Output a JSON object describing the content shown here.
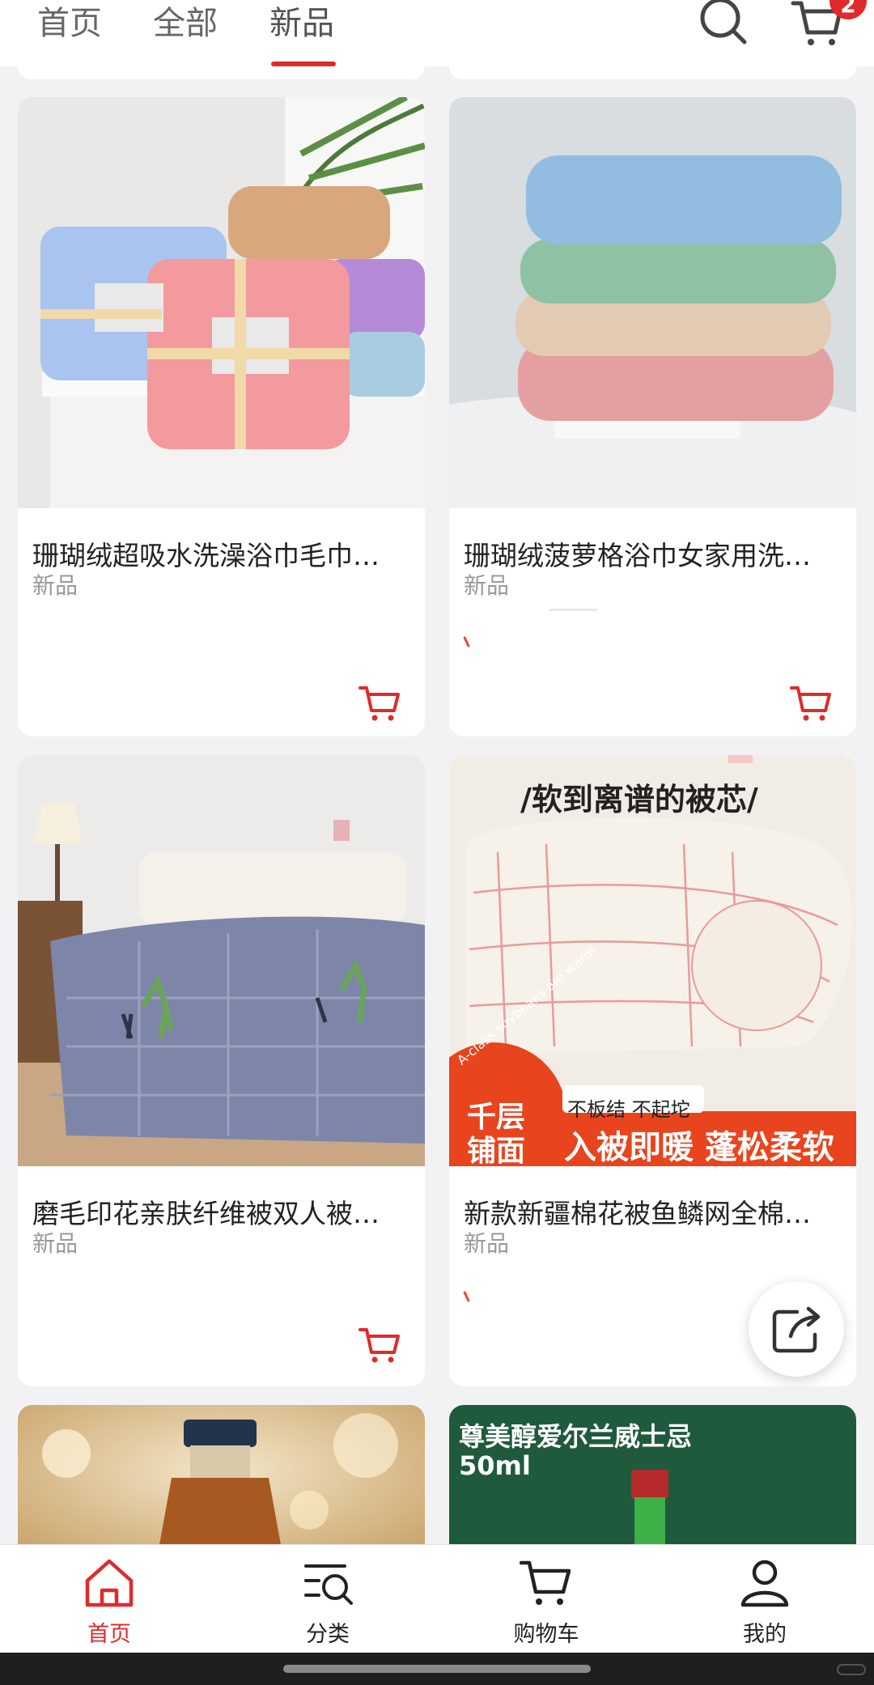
{
  "header": {
    "tabs": [
      {
        "label": "首页",
        "active": false
      },
      {
        "label": "全部",
        "active": false
      },
      {
        "label": "新品",
        "active": true
      }
    ],
    "cart_badge": "2",
    "icons": [
      "search-icon",
      "cart-icon"
    ]
  },
  "products": [
    {
      "title": "珊瑚绒超吸水洗澡浴巾毛巾…",
      "tag": "新品",
      "image": "pink-blue-towel-sets"
    },
    {
      "title": "珊瑚绒菠萝格浴巾女家用洗…",
      "tag": "新品",
      "image": "stacked-waffle-towels"
    },
    {
      "title": "磨毛印花亲肤纤维被双人被…",
      "tag": "新品",
      "image": "grey-deer-quilt-on-bed"
    },
    {
      "title": "新款新疆棉花被鱼鳞网全棉…",
      "tag": "新品",
      "image": "cotton-quilt-roll",
      "banner_top": "/软到离谱的被芯/",
      "banner_circle_1": "千层",
      "banner_circle_2": "铺面",
      "banner_note": "不板结 不起坨",
      "banner_bottom": "入被即暖 蓬松柔软",
      "banner_arc": "A-class soybeans are warm"
    },
    {
      "title": "",
      "tag": "",
      "image": "whisky-bottle-bokeh"
    },
    {
      "title": "",
      "tag": "",
      "image": "green-bottle-poster",
      "poster_line1": "尊美醇爱尔兰威士忌",
      "poster_line2": "50ml"
    }
  ],
  "bottom_nav": [
    {
      "label": "首页",
      "icon": "home-icon",
      "active": true
    },
    {
      "label": "分类",
      "icon": "category-search-icon",
      "active": false
    },
    {
      "label": "购物车",
      "icon": "cart-icon",
      "active": false
    },
    {
      "label": "我的",
      "icon": "user-icon",
      "active": false
    }
  ],
  "colors": {
    "accent": "#e02a2a",
    "background": "#f2f2f4"
  }
}
